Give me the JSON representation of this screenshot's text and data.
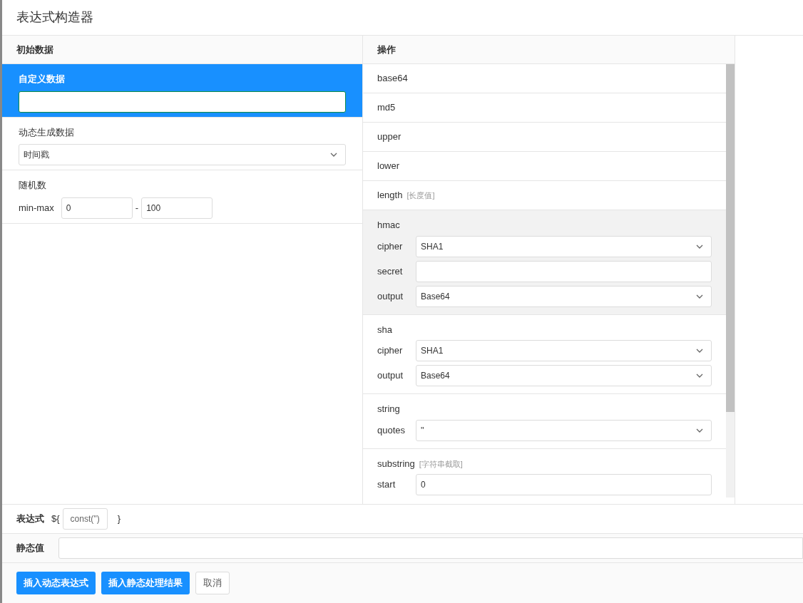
{
  "title": "表达式构造器",
  "source_panel": {
    "heading": "初始数据",
    "options": [
      {
        "kind": "input",
        "label": "自定义数据",
        "selected": true
      },
      {
        "kind": "select",
        "label": "动态生成数据",
        "value": "时间戳",
        "selected": false
      },
      {
        "kind": "range",
        "label": "随机数",
        "range_label": "min-max",
        "min": "0",
        "separator": "-",
        "max": "100",
        "selected": false
      }
    ]
  },
  "operations_panel": {
    "heading": "操作",
    "items": [
      {
        "name": "base64",
        "selected": false
      },
      {
        "name": "md5",
        "selected": false
      },
      {
        "name": "upper",
        "selected": false
      },
      {
        "name": "lower",
        "selected": false
      },
      {
        "name": "length",
        "hint": "[长度值]",
        "selected": false
      },
      {
        "name": "hmac",
        "selected": true,
        "fields": [
          {
            "kind": "select",
            "label": "cipher",
            "value": "SHA1"
          },
          {
            "kind": "input",
            "label": "secret"
          },
          {
            "kind": "select",
            "label": "output",
            "value": "Base64"
          }
        ]
      },
      {
        "name": "sha",
        "selected": false,
        "fields": [
          {
            "kind": "select",
            "label": "cipher",
            "value": "SHA1"
          },
          {
            "kind": "select",
            "label": "output",
            "value": "Base64"
          }
        ]
      },
      {
        "name": "string",
        "selected": false,
        "fields": [
          {
            "kind": "select",
            "label": "quotes",
            "value": "''"
          }
        ]
      },
      {
        "name": "substring",
        "hint": "[字符串截取]",
        "selected": false,
        "fields": [
          {
            "kind": "input",
            "label": "start",
            "value": "0"
          }
        ]
      }
    ]
  },
  "expression": {
    "label": "表达式",
    "prefix": "${",
    "value": "const('')",
    "suffix": "}"
  },
  "static_value": {
    "label": "静态值"
  },
  "buttons": [
    {
      "label": "插入动态表达式",
      "kind": "primary"
    },
    {
      "label": "插入静态处理结果",
      "kind": "primary"
    },
    {
      "label": "取消",
      "kind": "default"
    }
  ]
}
